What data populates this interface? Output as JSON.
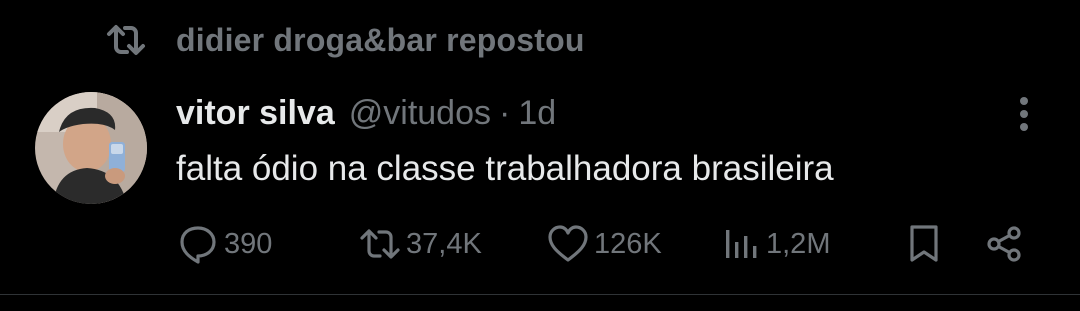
{
  "repost": {
    "icon": "repost-icon",
    "text": "didier droga&bar repostou"
  },
  "author": {
    "avatar_icon": "avatar",
    "display_name": "vitor silva",
    "handle": "@vitudos",
    "separator": "·",
    "time": "1d"
  },
  "tweet": {
    "text": "falta ódio na classe trabalhadora brasileira"
  },
  "actions": {
    "reply": {
      "icon": "reply-icon",
      "count": "390"
    },
    "retweet": {
      "icon": "retweet-icon",
      "count": "37,4K"
    },
    "like": {
      "icon": "heart-icon",
      "count": "126K"
    },
    "views": {
      "icon": "views-icon",
      "count": "1,2M"
    },
    "bookmark": {
      "icon": "bookmark-icon"
    },
    "share": {
      "icon": "share-icon"
    }
  },
  "colors": {
    "background": "#000000",
    "primary_text": "#e7e9ea",
    "secondary_text": "#71767b",
    "divider": "#2f3336"
  }
}
